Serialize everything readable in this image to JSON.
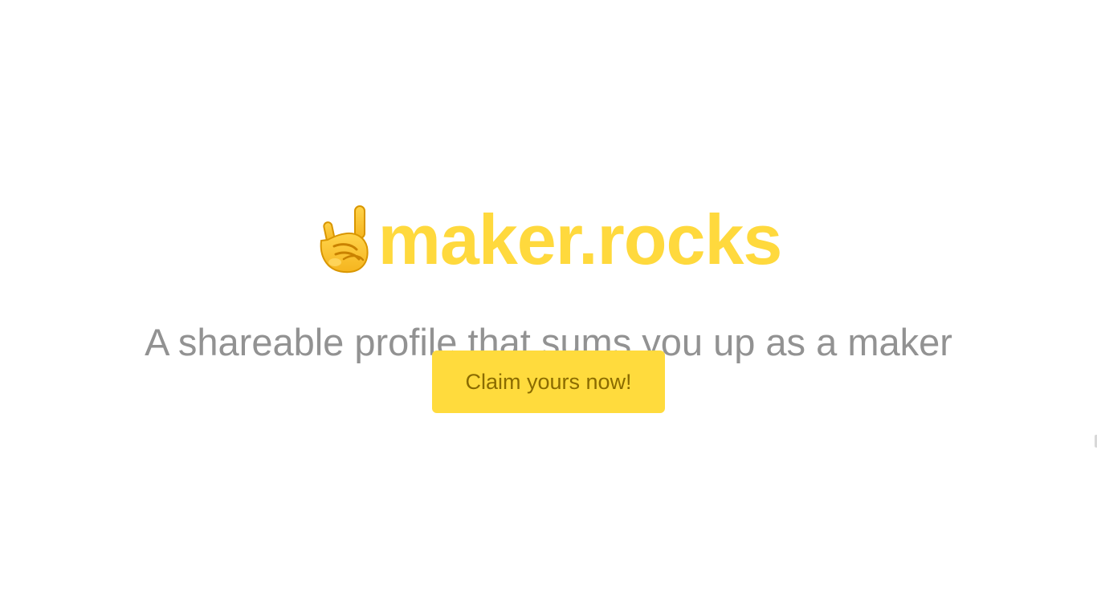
{
  "hero": {
    "logo_icon": "sign-of-the-horns-icon",
    "brand_name": "maker.rocks",
    "tagline": "A shareable profile that sums you up as a maker",
    "cta_label": "Claim yours now!"
  },
  "colors": {
    "background": "#ffffff",
    "brand_yellow": "#ffd93d",
    "button_yellow": "#ffdb3d",
    "button_text": "#8a6b00",
    "tagline_gray": "#929292"
  }
}
